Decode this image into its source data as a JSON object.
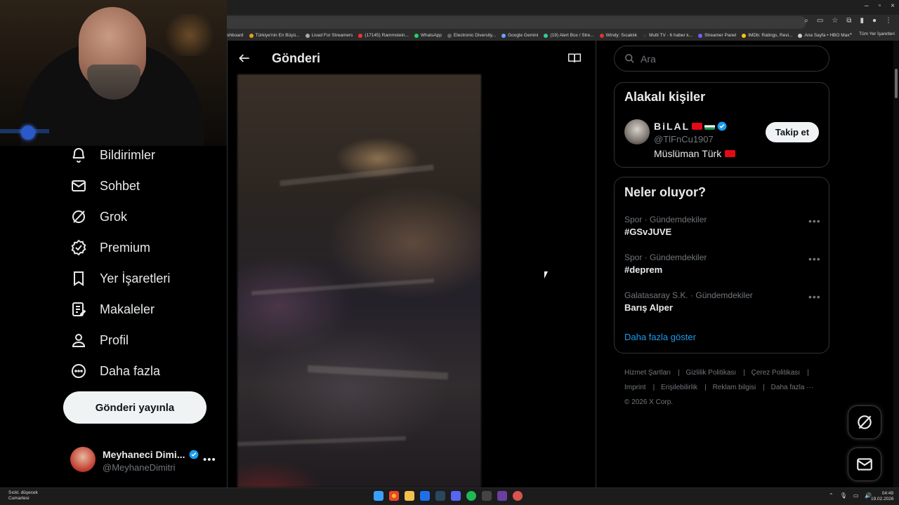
{
  "window": {
    "controls": [
      "–",
      "▫",
      "×"
    ]
  },
  "bookmarks": [
    "shboard",
    "Türkiye'nin En Büyü...",
    "Livad For Streamers",
    "(17145) Rammstein...",
    "WhatsApp",
    "Electronic Diversity...",
    "Google Gemini",
    "(19) Alert Box / Stre...",
    "Windy: Sıcaklık",
    "Multi TV - 6 haber k...",
    "Streamer Panel",
    "IMDb: Ratings, Revi...",
    "Ana Sayfa • HBO Max"
  ],
  "bookmarks_overflow": "»",
  "bookmarks_folder": "Tüm Yer İşaretleri",
  "sidebar": {
    "items": [
      {
        "label": "Bildirimler",
        "icon": "bell-icon"
      },
      {
        "label": "Sohbet",
        "icon": "mail-icon"
      },
      {
        "label": "Grok",
        "icon": "grok-icon"
      },
      {
        "label": "Premium",
        "icon": "verified-badge-icon"
      },
      {
        "label": "Yer İşaretleri",
        "icon": "bookmark-icon"
      },
      {
        "label": "Makaleler",
        "icon": "article-icon"
      },
      {
        "label": "Profil",
        "icon": "person-icon"
      },
      {
        "label": "Daha fazla",
        "icon": "more-circle-icon"
      }
    ],
    "post_button": "Gönderi yayınla",
    "account": {
      "name": "Meyhaneci Dimi...",
      "handle": "@MeyhaneDimitri",
      "more": "•••"
    }
  },
  "post": {
    "title": "Gönderi"
  },
  "search": {
    "placeholder": "Ara"
  },
  "related": {
    "title": "Alakalı kişiler",
    "person": {
      "name": "BiLAL",
      "handle": "@TlFnCu1907",
      "bio": "Müslüman Türk",
      "follow": "Takip et"
    }
  },
  "trends": {
    "title": "Neler oluyor?",
    "items": [
      {
        "meta": "Spor · Gündemdekiler",
        "name": "#GSvJUVE"
      },
      {
        "meta": "Spor · Gündemdekiler",
        "name": "#deprem"
      },
      {
        "meta": "Galatasaray S.K. · Gündemdekiler",
        "name": "Barış Alper"
      }
    ],
    "more": "•••",
    "show_more": "Daha fazla göster"
  },
  "footer": {
    "links": [
      "Hizmet Şartları",
      "Gizlilik Politikası",
      "Çerez Politikası",
      "Imprint",
      "Erişilebilirlik",
      "Reklam bilgisi",
      "Daha fazla ···"
    ],
    "copyright": "© 2026 X Corp."
  },
  "taskbar": {
    "weather_line1": "Sıckl. düşecek",
    "weather_line2": "Cumartesi",
    "time": "04:49",
    "date": "19.02.2026"
  },
  "colors": {
    "accent": "#1d9bf0",
    "bg": "#000000",
    "text": "#e7e9ea",
    "muted": "#71767b",
    "border": "#2f3336"
  }
}
